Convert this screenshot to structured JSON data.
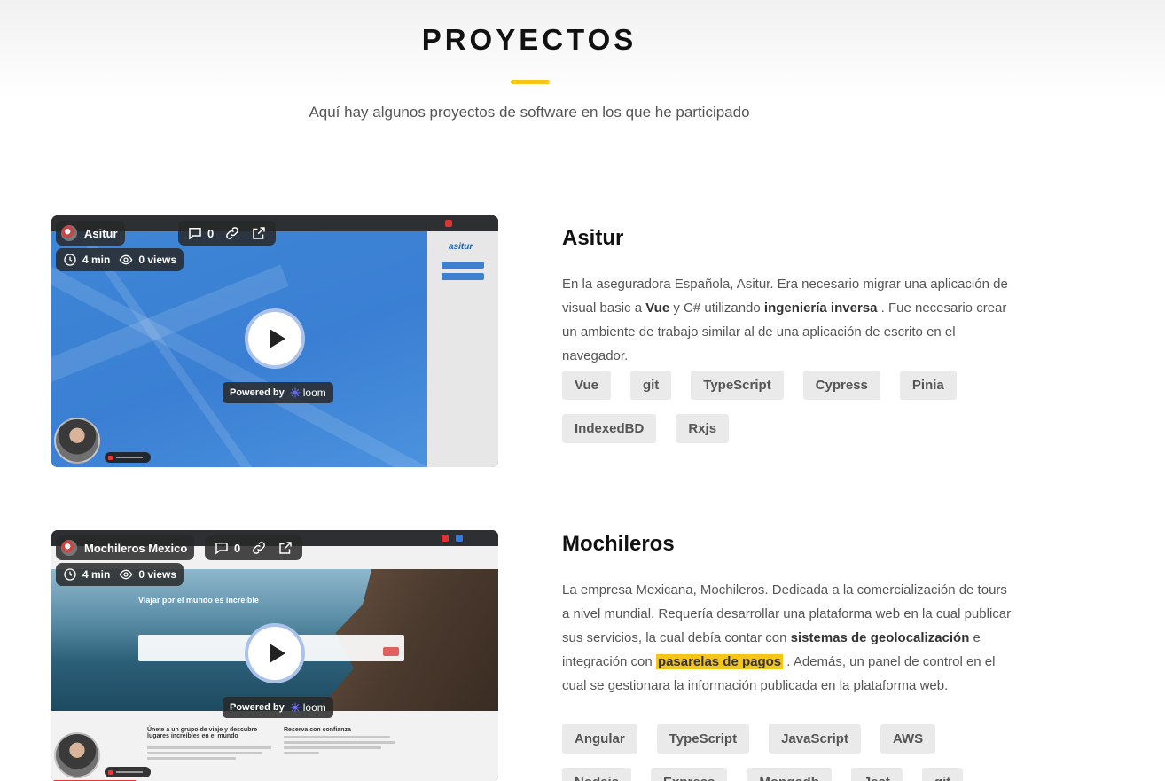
{
  "section": {
    "title": "PROYECTOS",
    "subtitle": "Aquí hay algunos proyectos de software en los que he participado"
  },
  "projects": [
    {
      "video": {
        "title": "Asitur",
        "comments": "0",
        "duration": "4 min",
        "views": "0 views",
        "powered_by": "Powered by",
        "brand": "loom",
        "site_logo": "asitur"
      },
      "title": "Asitur",
      "description": {
        "t1": "En la aseguradora Española, Asitur. Era necesario migrar una aplicación de visual basic a ",
        "b1": "Vue",
        "t2": " y C# utilizando ",
        "b2": "ingeniería inversa",
        "t3": " . Fue necesario crear un ambiente de trabajo similar al de una aplicación de escrito en el navegador."
      },
      "tags": [
        "Vue",
        "git",
        "TypeScript",
        "Cypress",
        "Pinia",
        "IndexedBD",
        "Rxjs"
      ]
    },
    {
      "video": {
        "title": "Mochileros Mexico",
        "comments": "0",
        "duration": "4 min",
        "views": "0 views",
        "powered_by": "Powered by",
        "brand": "loom",
        "hero_heading": "Viajar por el mundo es increíble",
        "lower_left": "Únete a un grupo de viaje y descubre lugares increíbles en el mundo",
        "lower_right": "Reserva con confianza"
      },
      "title": "Mochileros",
      "description": {
        "t1": "La empresa Mexicana, Mochileros. Dedicada a la comercialización de tours a nivel mundial. Requería desarrollar una plataforma web en la cual publicar sus servicios, la cual debía contar con ",
        "b1": "sistemas de geolocalización",
        "t2": " e integración con ",
        "h1": "pasarelas de pagos",
        "t3": " . Además, un panel de control en el cual se gestionara la información publicada en la plataforma web."
      },
      "tags": [
        "Angular",
        "TypeScript",
        "JavaScript",
        "AWS",
        "Nodejs",
        "Express",
        "Mongodb",
        "Jest",
        "git"
      ]
    }
  ],
  "icons": {
    "comment": "comment-icon",
    "link": "link-icon",
    "external": "external-link-icon",
    "clock": "clock-icon",
    "eye": "eye-icon",
    "play": "play-icon"
  },
  "colors": {
    "accent": "#f5c518",
    "tag_bg": "#eaeaea",
    "heading": "#111111",
    "body_text": "#555555"
  }
}
